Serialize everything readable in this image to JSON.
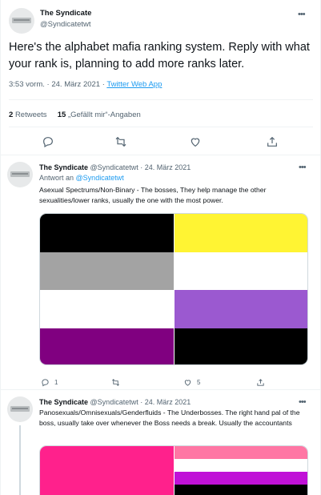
{
  "tweet": {
    "author_name": "The Syndicate",
    "author_handle": "@Syndicatetwt",
    "text": "Here's the alphabet mafia ranking system. Reply with what your rank is, planning to add more ranks later.",
    "time": "3:53 vorm.",
    "date": "24. März 2021",
    "separator": "·",
    "source": "Twitter Web App",
    "retweets_count": "2",
    "retweets_label": "Retweets",
    "likes_count": "15",
    "likes_label": "„Gefällt mir“-Angaben"
  },
  "actions": {
    "icons": [
      "reply-icon",
      "retweet-icon",
      "like-icon",
      "share-icon"
    ]
  },
  "replies": [
    {
      "author_name": "The Syndicate",
      "author_handle": "@Syndicatetwt",
      "separator": "·",
      "date": "24. März 2021",
      "reply_to_prefix": "Antwort an",
      "reply_to_handle": "@Syndicatetwt",
      "text": "Asexual Spectrums/Non-Binary - The bosses, They help manage the other sexualities/lower ranks, usually the one with the most power.",
      "flags": [
        {
          "name": "asexual-flag",
          "stripes": [
            "#000000",
            "#a3a3a3",
            "#ffffff",
            "#800080"
          ]
        },
        {
          "name": "nonbinary-flag",
          "stripes": [
            "#fff433",
            "#ffffff",
            "#9b59d0",
            "#000000"
          ]
        }
      ],
      "reply_count": "1",
      "retweet_count": "",
      "like_count": "5"
    },
    {
      "author_name": "The Syndicate",
      "author_handle": "@Syndicatetwt",
      "separator": "·",
      "date": "24. März 2021",
      "text": "Panosexuals/Omnisexuals/Genderfluids - The Underbosses. The right hand pal of the boss, usually take over whenever the Boss needs a break. Usually the accountants",
      "flags": [
        {
          "name": "pansexual-flag",
          "stripes": [
            "#ff218c",
            "#ff218c",
            "#ff218c"
          ]
        },
        {
          "name": "genderfluid-flag",
          "stripes": [
            "#ff76a4",
            "#ffffff",
            "#c011d7",
            "#000000",
            "#2f3cbe"
          ]
        }
      ]
    }
  ],
  "colors": {
    "link": "#1d9bf0",
    "muted": "#536471",
    "text": "#0f1419",
    "border": "#eff3f4"
  }
}
